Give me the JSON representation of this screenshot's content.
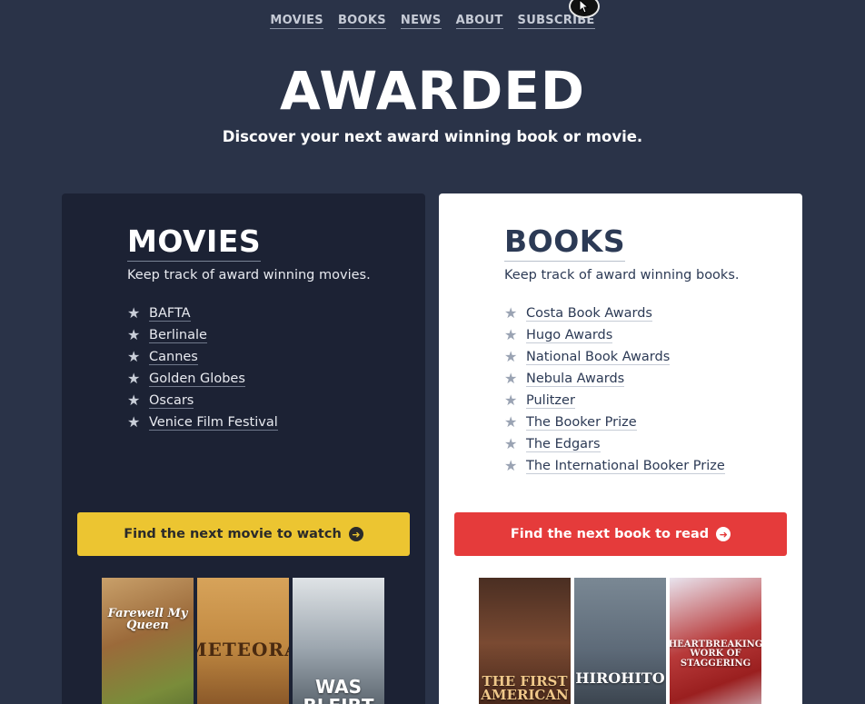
{
  "nav": {
    "items": [
      {
        "label": "MOVIES"
      },
      {
        "label": "BOOKS"
      },
      {
        "label": "NEWS"
      },
      {
        "label": "ABOUT"
      },
      {
        "label": "SUBSCRIBE"
      }
    ]
  },
  "hero": {
    "title": "AWARDED",
    "subtitle": "Discover your next award winning book or movie."
  },
  "movies": {
    "title": "MOVIES",
    "description": "Keep track of award winning movies.",
    "awards": [
      "BAFTA",
      "Berlinale",
      "Cannes",
      "Golden Globes",
      "Oscars",
      "Venice Film Festival"
    ],
    "cta_label": "Find the next movie to watch",
    "posters": [
      "Farewell My Queen",
      "METEORA",
      "WAS BLEIBT"
    ]
  },
  "books": {
    "title": "BOOKS",
    "description": "Keep track of award winning books.",
    "awards": [
      "Costa Book Awards",
      "Hugo Awards",
      "National Book Awards",
      "Nebula Awards",
      "Pulitzer",
      "The Booker Prize",
      "The Edgars",
      "The International Booker Prize"
    ],
    "cta_label": "Find the next book to read",
    "covers": [
      "THE FIRST AMERICAN",
      "HIROHITO",
      "HEARTBREAKING WORK OF STAGGERING"
    ]
  },
  "colors": {
    "page_bg": "#2a3348",
    "movies_card_bg": "#1c2234",
    "books_card_bg": "#ffffff",
    "movies_cta": "#ecc531",
    "books_cta": "#e53b3b"
  },
  "icons": {
    "star": "star-icon",
    "arrow": "arrow-right-circle-icon",
    "cursor": "mouse-pointer-icon"
  }
}
